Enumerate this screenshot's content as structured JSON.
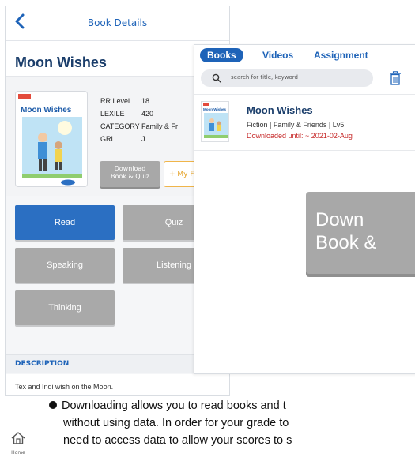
{
  "left_panel": {
    "header_title": "Book Details",
    "book_title": "Moon Wishes",
    "cover_title": "Moon Wishes",
    "info": [
      {
        "label": "RR Level",
        "value": "18"
      },
      {
        "label": "LEXILE",
        "value": "420"
      },
      {
        "label": "CATEGORY",
        "value": "Family & Fr"
      },
      {
        "label": "GRL",
        "value": "J"
      }
    ],
    "download_button": "Download\nBook & Quiz",
    "favorite_button": "+ My Fa",
    "activities": {
      "read": "Read",
      "quiz": "Quiz",
      "speaking": "Speaking",
      "listening": "Listening",
      "thinking": "Thinking"
    },
    "description_heading": "DESCRIPTION",
    "description_text": "Tex and Indi wish on the Moon."
  },
  "right_panel": {
    "tabs": [
      "Books",
      "Videos",
      "Assignment"
    ],
    "search_placeholder": "search for title, keyword",
    "row": {
      "thumb_title": "Moon Wishes",
      "title": "Moon Wishes",
      "meta": "Fiction | Family & Friends | Lv5",
      "downloaded": "Downloaded until: ~ 2021-02-Aug"
    },
    "big_button_line1": "Down",
    "big_button_line2": "Book &"
  },
  "note": {
    "line1": "Downloading allows you to read books and t",
    "line2": "without using data. In order for your grade to",
    "line3": "need to access data to allow your scores to s"
  },
  "nav": {
    "home_label": "Home"
  },
  "colors": {
    "accent": "#1e63b8",
    "title": "#1b3e6b",
    "gray_button": "#a9a9a9",
    "alert": "#c62828",
    "fav": "#f0b54a"
  }
}
